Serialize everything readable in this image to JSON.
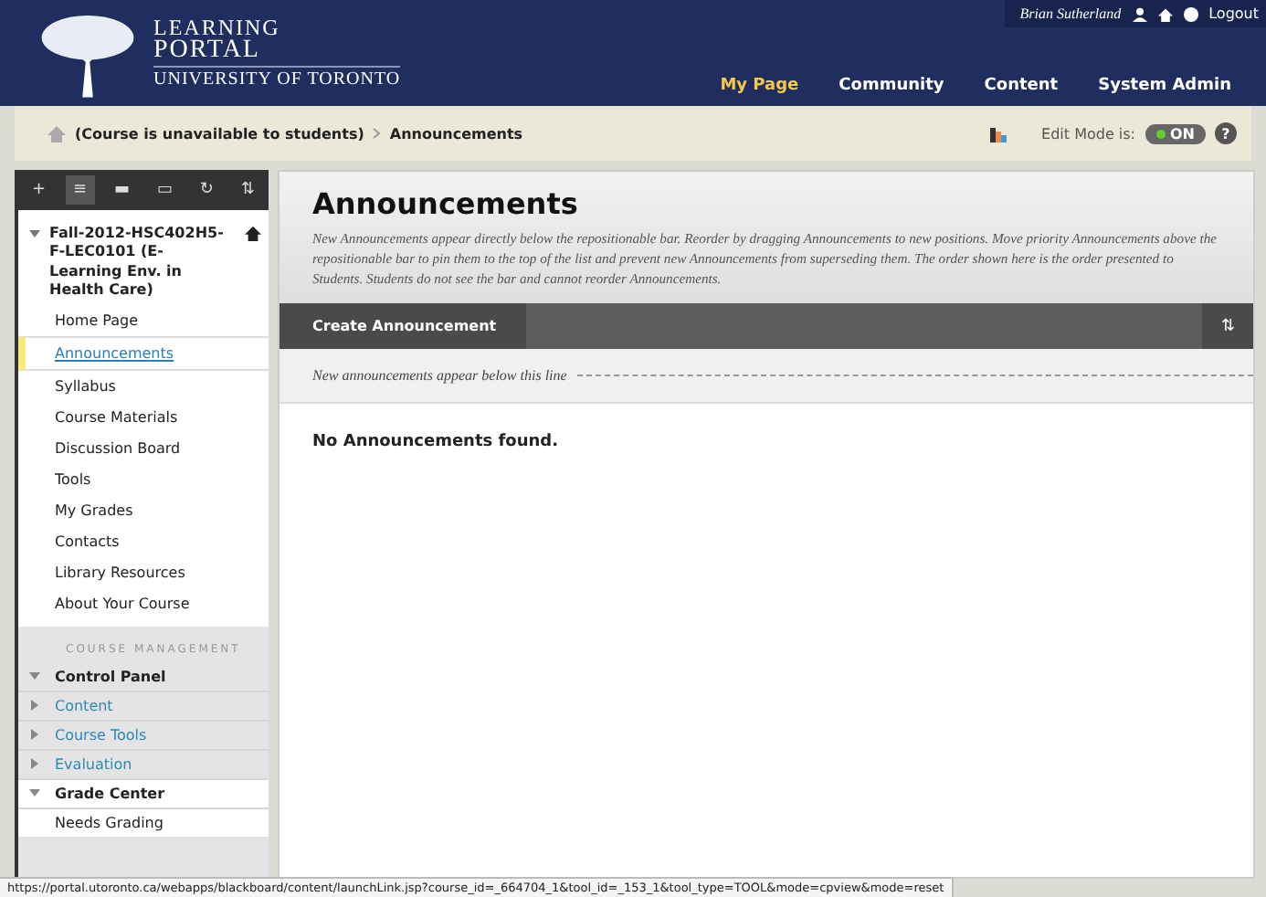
{
  "header": {
    "logo_lines": [
      "LEARNING",
      "PORTAL",
      "UNIVERSITY OF TORONTO"
    ],
    "user": "Brian Sutherland",
    "logout": "Logout",
    "tabs": [
      {
        "label": "My Page",
        "selected": true
      },
      {
        "label": "Community",
        "selected": false
      },
      {
        "label": "Content",
        "selected": false
      },
      {
        "label": "System Admin",
        "selected": false
      }
    ]
  },
  "breadcrumb": {
    "items": [
      "(Course is unavailable to students)",
      "Announcements"
    ],
    "edit_mode_label": "Edit Mode is:",
    "edit_mode": {
      "on": true,
      "label": "ON"
    },
    "help": "?"
  },
  "sidebar": {
    "toolbar": [
      {
        "label": "+",
        "selected": false
      },
      {
        "label": "≡",
        "selected": true
      },
      {
        "label": "▬",
        "selected": false
      },
      {
        "label": "▭",
        "selected": false
      },
      {
        "label": "↻",
        "selected": false
      },
      {
        "label": "⇅",
        "selected": false
      }
    ],
    "course_title": "Fall-2012-HSC402H5-F-LEC0101 (E-Learning Env. in Health Care)",
    "items": [
      {
        "label": "Home Page",
        "selected": false
      },
      {
        "label": "Announcements",
        "selected": true
      },
      {
        "label": "Syllabus",
        "selected": false
      },
      {
        "label": "Course Materials",
        "selected": false
      },
      {
        "label": "Discussion Board",
        "selected": false
      },
      {
        "label": "Tools",
        "selected": false
      },
      {
        "label": "My Grades",
        "selected": false
      },
      {
        "label": "Contacts",
        "selected": false
      },
      {
        "label": "Library Resources",
        "selected": false
      },
      {
        "label": "About Your Course",
        "selected": false
      }
    ],
    "management_heading": "COURSE MANAGEMENT",
    "management": [
      {
        "label": "Control Panel",
        "kind": "section",
        "expanded": true
      },
      {
        "label": "Content",
        "kind": "link",
        "expanded": false
      },
      {
        "label": "Course Tools",
        "kind": "link",
        "expanded": false
      },
      {
        "label": "Evaluation",
        "kind": "link",
        "expanded": false
      },
      {
        "label": "Grade Center",
        "kind": "section",
        "expanded": true
      },
      {
        "label": "Needs Grading",
        "kind": "sub"
      }
    ]
  },
  "content": {
    "title": "Announcements",
    "description": "New Announcements appear directly below the repositionable bar. Reorder by dragging Announcements to new positions. Move priority Announcements above the repositionable bar to pin them to the top of the list and prevent new Announcements from superseding them. The order shown here is the order presented to Students. Students do not see the bar and cannot reorder Announcements.",
    "action": "Create Announcement",
    "sort": "⇅",
    "divider_note": "New announcements appear below this line",
    "empty": "No Announcements found."
  },
  "status_bar": "https://portal.utoronto.ca/webapps/blackboard/content/launchLink.jsp?course_id=_664704_1&tool_id=_153_1&tool_type=TOOL&mode=cpview&mode=reset"
}
